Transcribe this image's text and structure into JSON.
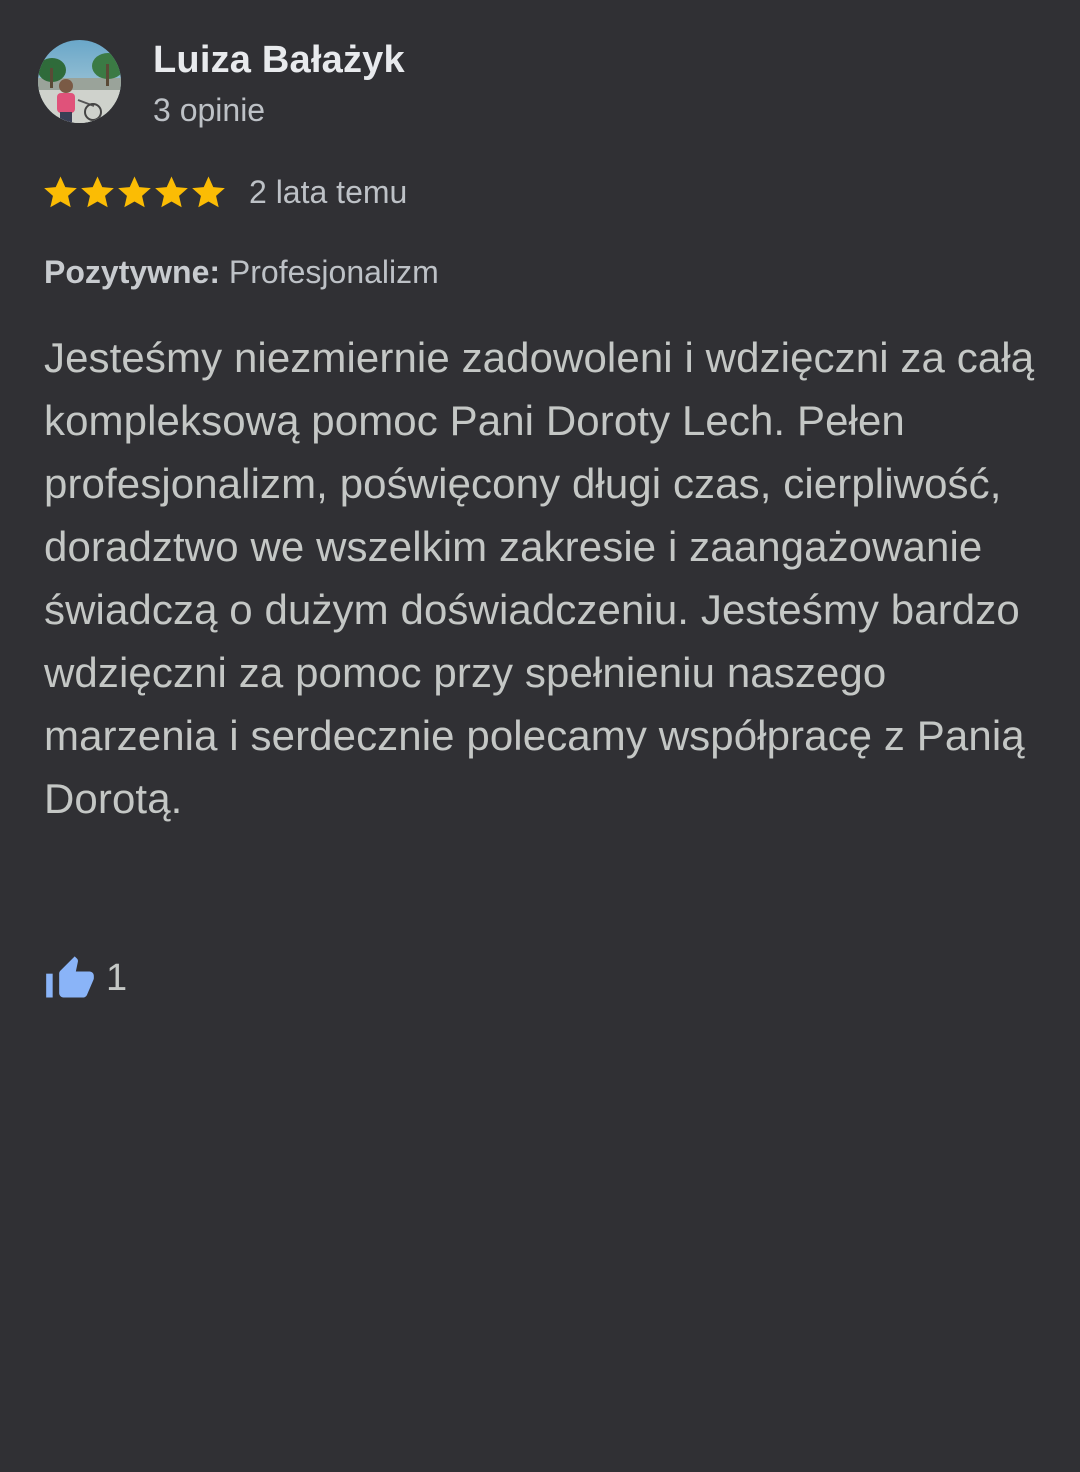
{
  "review": {
    "author": {
      "name": "Luiza Bałażyk",
      "meta": "3 opinie"
    },
    "rating": {
      "stars": 5,
      "max": 5,
      "time": "2 lata temu"
    },
    "highlights": {
      "label": "Pozytywne:",
      "value": "Profesjonalizm"
    },
    "text": "Jesteśmy niezmiernie zadowoleni i wdzięczni za całą kompleksową pomoc Pani Doroty Lech. Pełen profesjonalizm, poświęcony długi czas, cierpliwość, doradztwo we wszelkim zakresie i zaangażowanie świadczą o dużym doświadczeniu. Jesteśmy bardzo wdzięczni za pomoc przy spełnieniu naszego marzenia i serdecznie polecamy współpracę z Panią Dorotą.",
    "likes": "1"
  },
  "colors": {
    "background": "#303034",
    "star": "#fbbc04",
    "like": "#8ab4f8"
  },
  "icons": {
    "star": "star-icon",
    "like": "thumbs-up-icon"
  }
}
